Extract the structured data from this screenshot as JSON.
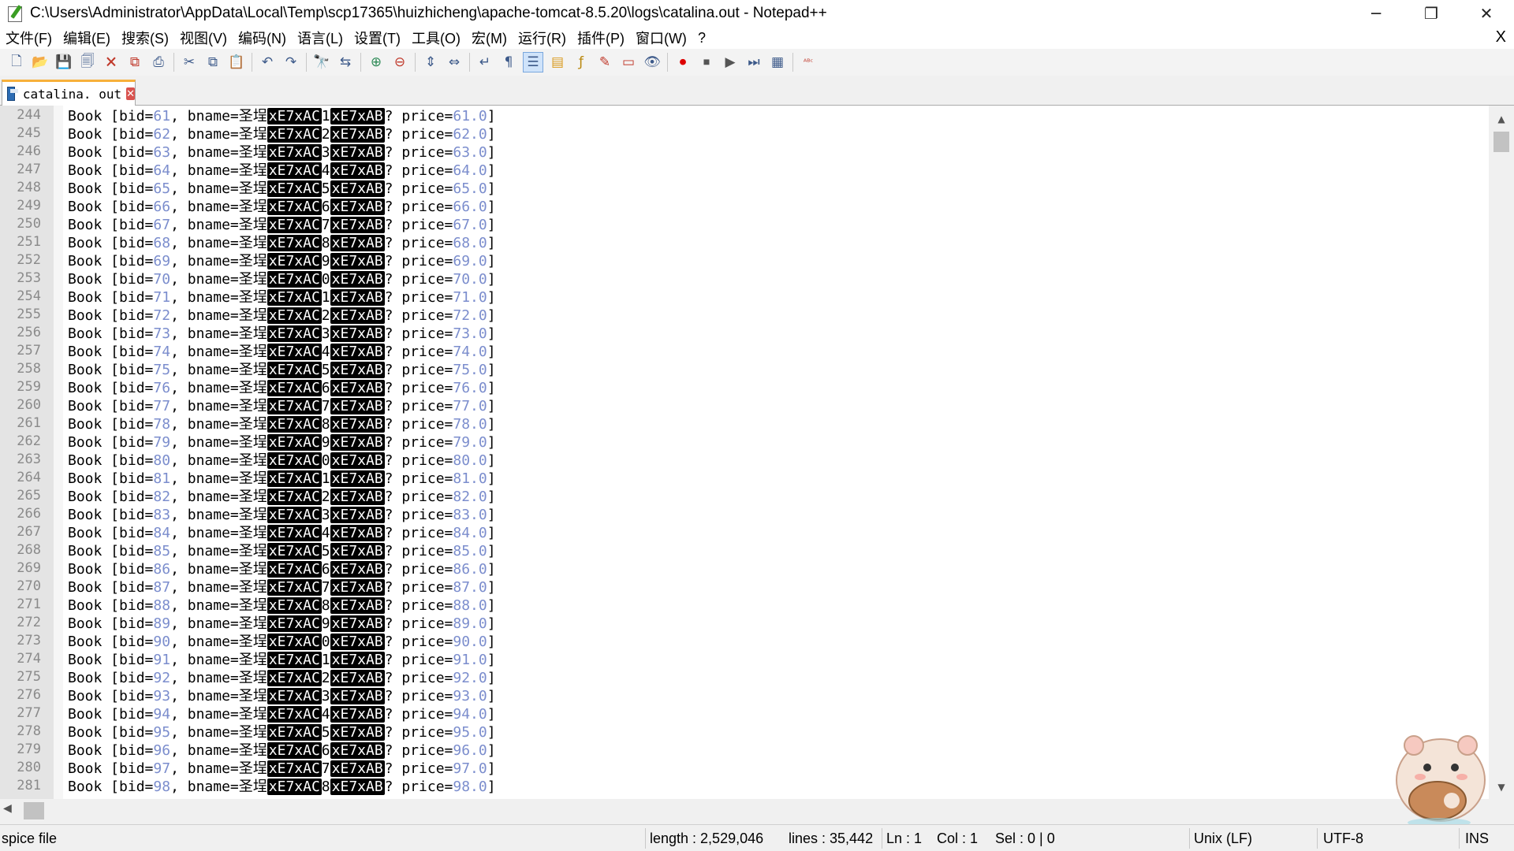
{
  "window": {
    "title": "C:\\Users\\Administrator\\AppData\\Local\\Temp\\scp17365\\huizhicheng\\apache-tomcat-8.5.20\\logs\\catalina.out - Notepad++",
    "minimize": "─",
    "restore": "❐",
    "close": "✕"
  },
  "menu": {
    "items": [
      "文件(F)",
      "编辑(E)",
      "搜索(S)",
      "视图(V)",
      "编码(N)",
      "语言(L)",
      "设置(T)",
      "工具(O)",
      "宏(M)",
      "运行(R)",
      "插件(P)",
      "窗口(W)",
      "?"
    ],
    "close_doc": "X"
  },
  "toolbar": {
    "icons": [
      "new-file-icon",
      "open-file-icon",
      "save-icon",
      "save-all-icon",
      "close-icon",
      "close-all-icon",
      "print-icon",
      "cut-icon",
      "copy-icon",
      "paste-icon",
      "undo-icon",
      "redo-icon",
      "find-icon",
      "replace-icon",
      "zoom-in-icon",
      "zoom-out-icon",
      "sync-vertical-icon",
      "sync-horizontal-icon",
      "word-wrap-icon",
      "show-all-chars-icon",
      "indent-guide-icon",
      "doc-map-icon",
      "function-list-icon",
      "folder-workspace-icon",
      "doc-switcher-icon",
      "monitor-icon",
      "record-macro-icon",
      "stop-record-icon",
      "play-macro-icon",
      "run-macro-multiple-icon",
      "save-macro-icon",
      "spell-check-icon"
    ]
  },
  "tab": {
    "label": "catalina. out",
    "close": "✕"
  },
  "editor": {
    "prefix": "Book [bid=",
    "mid": ", bname=圣埕",
    "ctrl1": "xE7xAC",
    "ctrl2": "xE7xAB",
    "after": "? price=",
    "suffix": "]",
    "lines": [
      {
        "ln": "244",
        "bid": "61",
        "d": "1",
        "price": "61.0"
      },
      {
        "ln": "245",
        "bid": "62",
        "d": "2",
        "price": "62.0"
      },
      {
        "ln": "246",
        "bid": "63",
        "d": "3",
        "price": "63.0"
      },
      {
        "ln": "247",
        "bid": "64",
        "d": "4",
        "price": "64.0"
      },
      {
        "ln": "248",
        "bid": "65",
        "d": "5",
        "price": "65.0"
      },
      {
        "ln": "249",
        "bid": "66",
        "d": "6",
        "price": "66.0"
      },
      {
        "ln": "250",
        "bid": "67",
        "d": "7",
        "price": "67.0"
      },
      {
        "ln": "251",
        "bid": "68",
        "d": "8",
        "price": "68.0"
      },
      {
        "ln": "252",
        "bid": "69",
        "d": "9",
        "price": "69.0"
      },
      {
        "ln": "253",
        "bid": "70",
        "d": "0",
        "price": "70.0"
      },
      {
        "ln": "254",
        "bid": "71",
        "d": "1",
        "price": "71.0"
      },
      {
        "ln": "255",
        "bid": "72",
        "d": "2",
        "price": "72.0"
      },
      {
        "ln": "256",
        "bid": "73",
        "d": "3",
        "price": "73.0"
      },
      {
        "ln": "257",
        "bid": "74",
        "d": "4",
        "price": "74.0"
      },
      {
        "ln": "258",
        "bid": "75",
        "d": "5",
        "price": "75.0"
      },
      {
        "ln": "259",
        "bid": "76",
        "d": "6",
        "price": "76.0"
      },
      {
        "ln": "260",
        "bid": "77",
        "d": "7",
        "price": "77.0"
      },
      {
        "ln": "261",
        "bid": "78",
        "d": "8",
        "price": "78.0"
      },
      {
        "ln": "262",
        "bid": "79",
        "d": "9",
        "price": "79.0"
      },
      {
        "ln": "263",
        "bid": "80",
        "d": "0",
        "price": "80.0"
      },
      {
        "ln": "264",
        "bid": "81",
        "d": "1",
        "price": "81.0"
      },
      {
        "ln": "265",
        "bid": "82",
        "d": "2",
        "price": "82.0"
      },
      {
        "ln": "266",
        "bid": "83",
        "d": "3",
        "price": "83.0"
      },
      {
        "ln": "267",
        "bid": "84",
        "d": "4",
        "price": "84.0"
      },
      {
        "ln": "268",
        "bid": "85",
        "d": "5",
        "price": "85.0"
      },
      {
        "ln": "269",
        "bid": "86",
        "d": "6",
        "price": "86.0"
      },
      {
        "ln": "270",
        "bid": "87",
        "d": "7",
        "price": "87.0"
      },
      {
        "ln": "271",
        "bid": "88",
        "d": "8",
        "price": "88.0"
      },
      {
        "ln": "272",
        "bid": "89",
        "d": "9",
        "price": "89.0"
      },
      {
        "ln": "273",
        "bid": "90",
        "d": "0",
        "price": "90.0"
      },
      {
        "ln": "274",
        "bid": "91",
        "d": "1",
        "price": "91.0"
      },
      {
        "ln": "275",
        "bid": "92",
        "d": "2",
        "price": "92.0"
      },
      {
        "ln": "276",
        "bid": "93",
        "d": "3",
        "price": "93.0"
      },
      {
        "ln": "277",
        "bid": "94",
        "d": "4",
        "price": "94.0"
      },
      {
        "ln": "278",
        "bid": "95",
        "d": "5",
        "price": "95.0"
      },
      {
        "ln": "279",
        "bid": "96",
        "d": "6",
        "price": "96.0"
      },
      {
        "ln": "280",
        "bid": "97",
        "d": "7",
        "price": "97.0"
      },
      {
        "ln": "281",
        "bid": "98",
        "d": "8",
        "price": "98.0"
      }
    ]
  },
  "statusbar": {
    "file_type": "spice file",
    "length": "length : 2,529,046",
    "lines": "lines : 35,442",
    "ln": "Ln : 1",
    "col": "Col : 1",
    "sel": "Sel : 0 | 0",
    "eol": "Unix (LF)",
    "encoding": "UTF-8",
    "mode": "INS"
  },
  "colors": {
    "number": "#7b8dcd",
    "ctrl_bg": "#000000",
    "gutter": "#e4e4e4",
    "tab_accent": "#f7b03b"
  }
}
